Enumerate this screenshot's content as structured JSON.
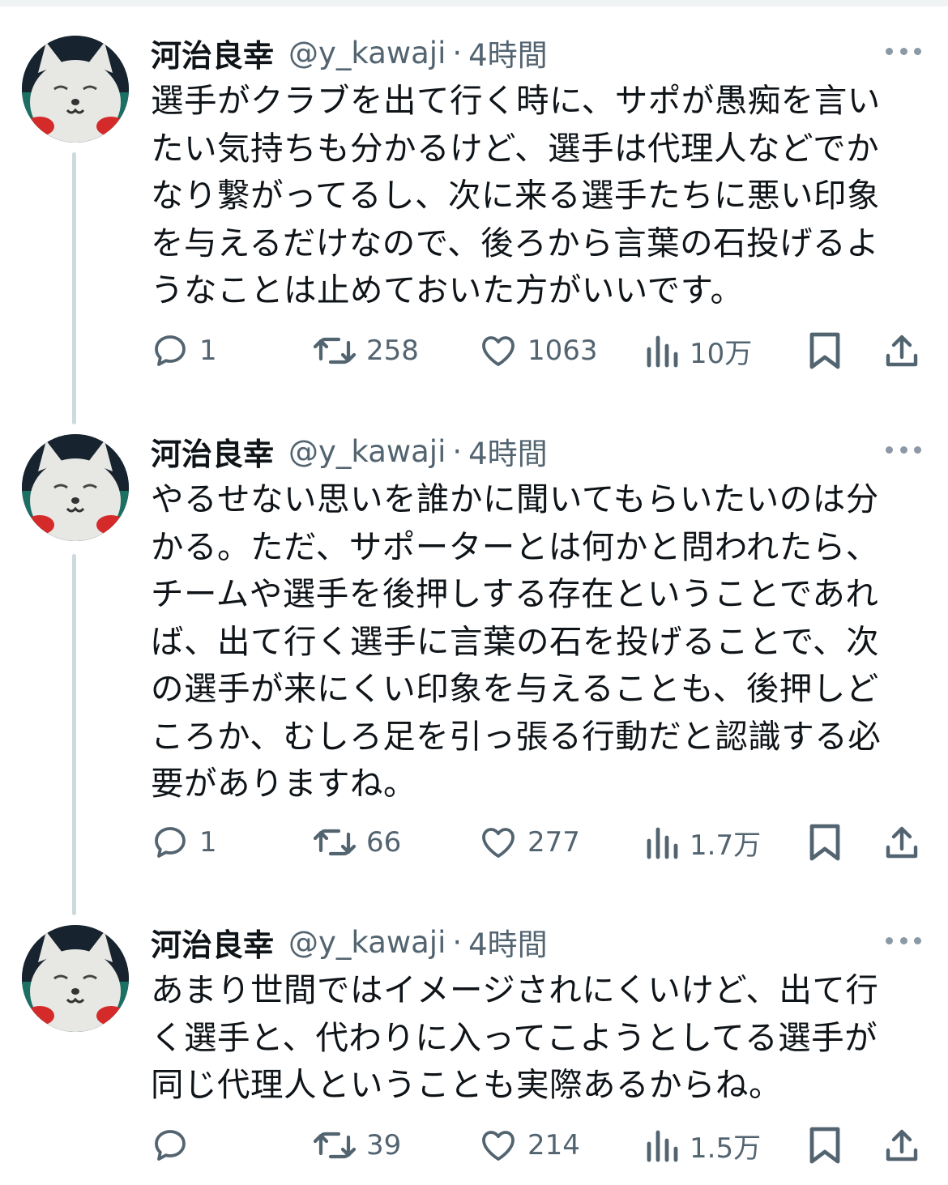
{
  "tweets": [
    {
      "author": {
        "name": "河治良幸",
        "handle": "@y_kawaji",
        "separator": "·",
        "time": "4時間"
      },
      "lines": [
        "選手がクラブを出て行く時に、サポが愚痴を言い",
        "たい気持ちも分かるけど、選手は代理人などでか",
        "なり繋がってるし、次に来る選手たちに悪い印象",
        "を与えるだけなので、後ろから言葉の石投げるよ",
        "うなことは止めておいた方がいいです。"
      ],
      "metrics": {
        "replies": "1",
        "reposts": "258",
        "likes": "1063",
        "views": "10万"
      }
    },
    {
      "author": {
        "name": "河治良幸",
        "handle": "@y_kawaji",
        "separator": "·",
        "time": "4時間"
      },
      "lines": [
        "やるせない思いを誰かに聞いてもらいたいのは分",
        "かる。ただ、サポーターとは何かと問われたら、",
        "チームや選手を後押しする存在ということであれ",
        "ば、出て行く選手に言葉の石を投げることで、次",
        "の選手が来にくい印象を与えることも、後押しど",
        "ころか、むしろ足を引っ張る行動だと認識する必",
        "要がありますね。"
      ],
      "metrics": {
        "replies": "1",
        "reposts": "66",
        "likes": "277",
        "views": "1.7万"
      }
    },
    {
      "author": {
        "name": "河治良幸",
        "handle": "@y_kawaji",
        "separator": "·",
        "time": "4時間"
      },
      "lines": [
        "あまり世間ではイメージされにくいけど、出て行",
        "く選手と、代わりに入ってこようとしてる選手が",
        "同じ代理人ということも実際あるからね。"
      ],
      "metrics": {
        "replies": "",
        "reposts": "39",
        "likes": "214",
        "views": "1.5万"
      }
    }
  ],
  "icons": {
    "reply": "reply-icon",
    "repost": "repost-icon",
    "like": "heart-icon",
    "views": "views-icon",
    "bookmark": "bookmark-icon",
    "share": "share-icon",
    "more": "more-icon"
  },
  "colors": {
    "text": "#0f1419",
    "secondary": "#536471",
    "thread": "#cfd9de"
  }
}
